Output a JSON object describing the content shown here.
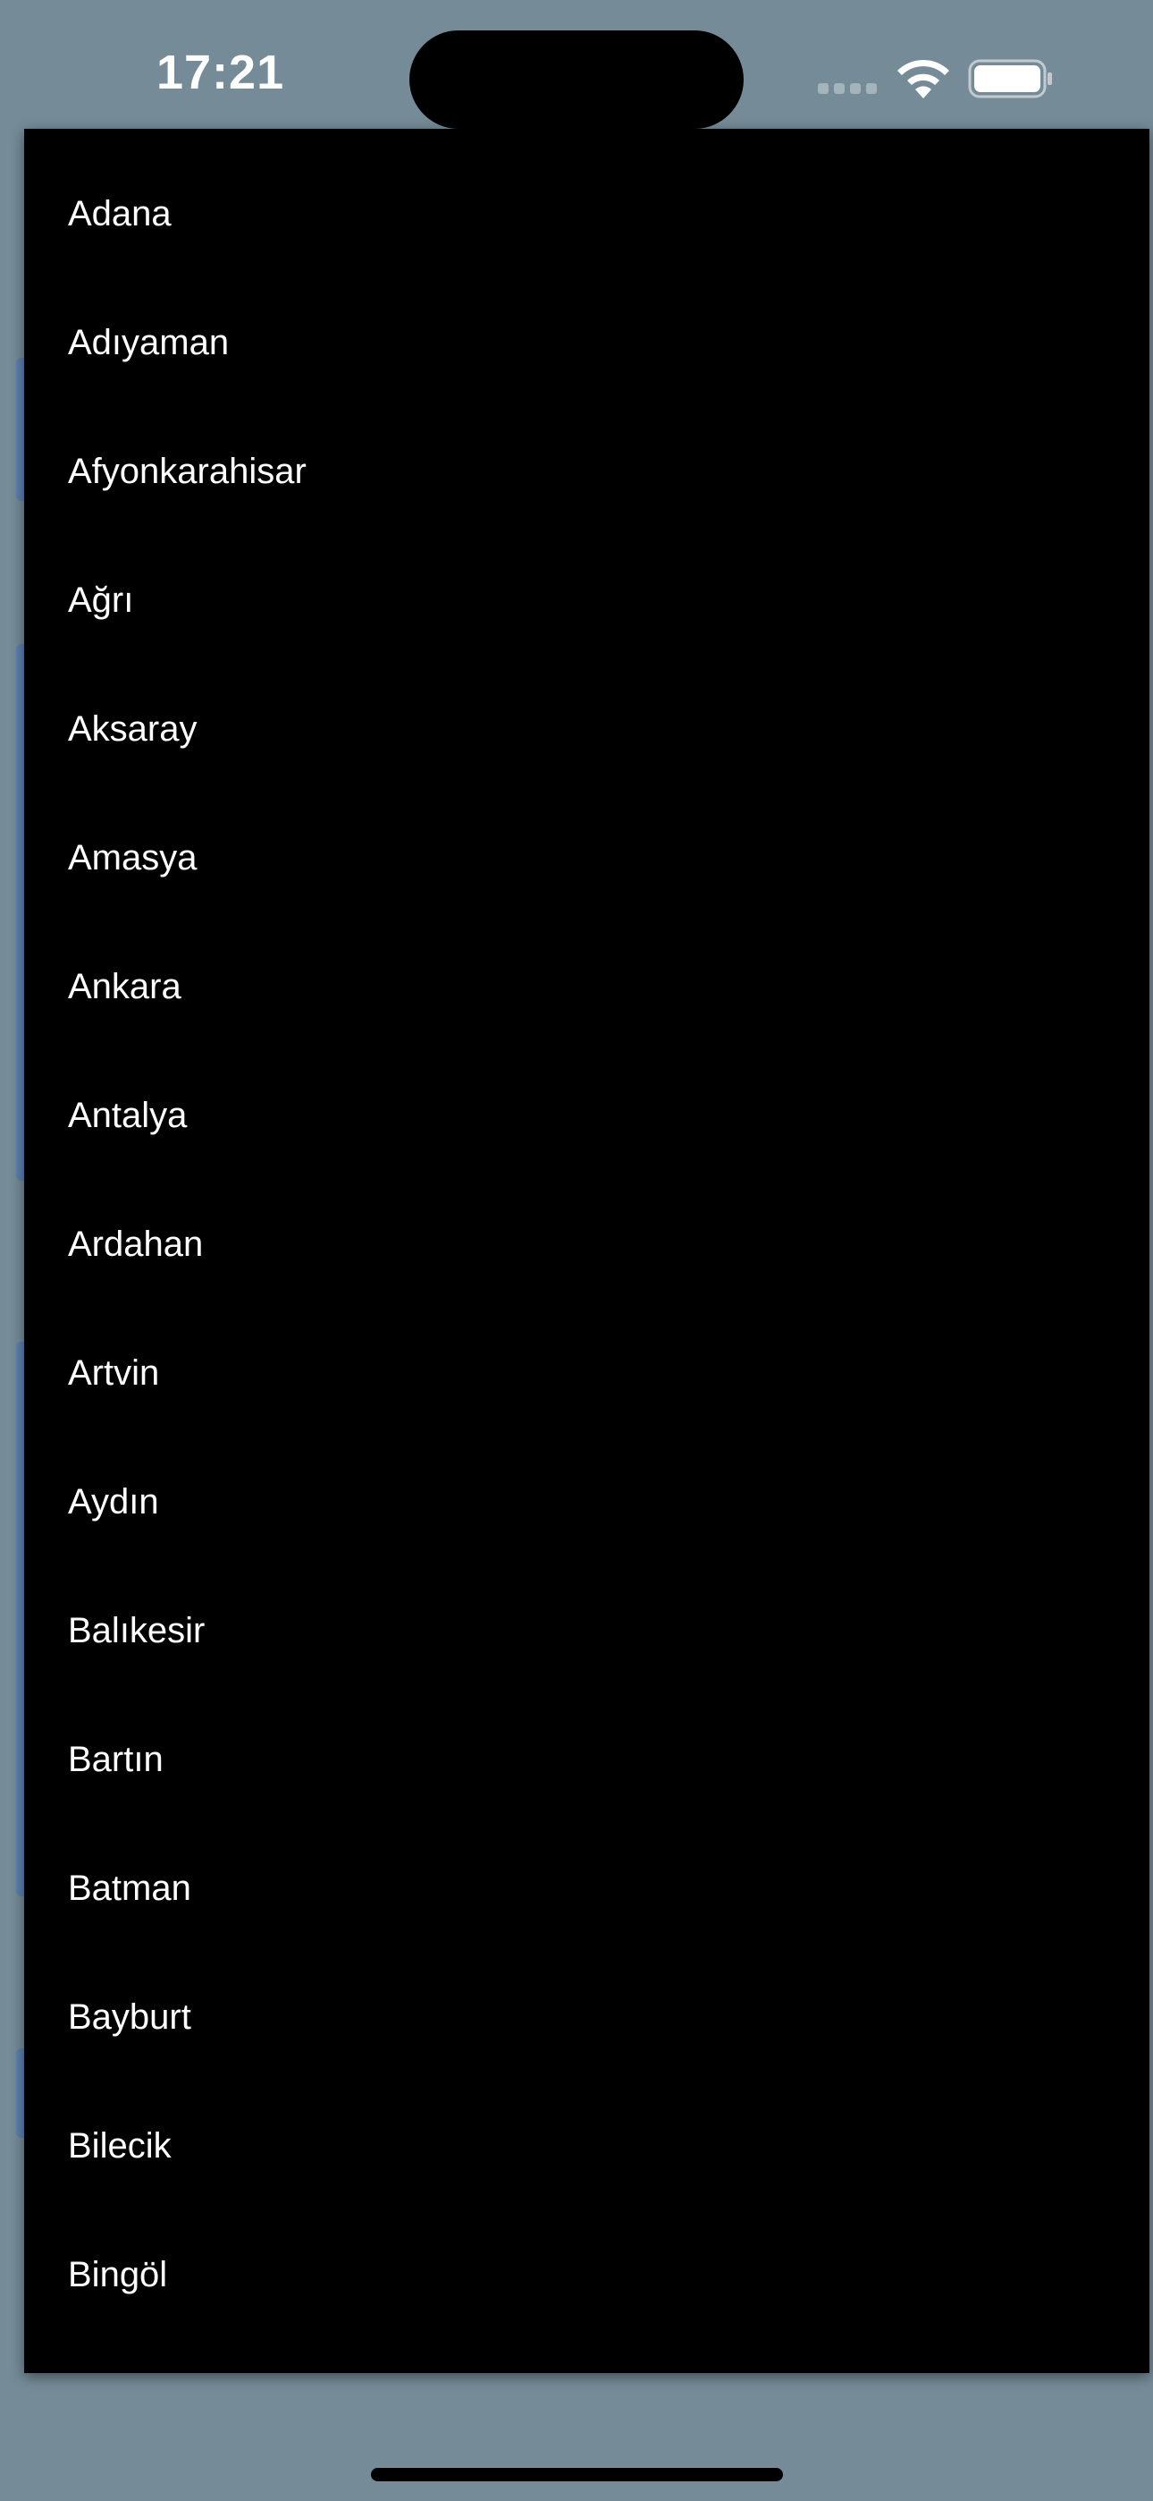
{
  "status_bar": {
    "time": "17:21",
    "icons": [
      "signal-icon",
      "wifi-icon",
      "battery-icon"
    ]
  },
  "menu": {
    "items": [
      {
        "label": "Adana"
      },
      {
        "label": "Adıyaman"
      },
      {
        "label": "Afyonkarahisar"
      },
      {
        "label": "Ağrı"
      },
      {
        "label": "Aksaray"
      },
      {
        "label": "Amasya"
      },
      {
        "label": "Ankara"
      },
      {
        "label": "Antalya"
      },
      {
        "label": "Ardahan"
      },
      {
        "label": "Artvin"
      },
      {
        "label": "Aydın"
      },
      {
        "label": "Balıkesir"
      },
      {
        "label": "Bartın"
      },
      {
        "label": "Batman"
      },
      {
        "label": "Bayburt"
      },
      {
        "label": "Bilecik"
      },
      {
        "label": "Bingöl"
      }
    ]
  },
  "colors": {
    "background": "#758b97",
    "menu_background": "#000000",
    "menu_text": "#ffffff"
  }
}
